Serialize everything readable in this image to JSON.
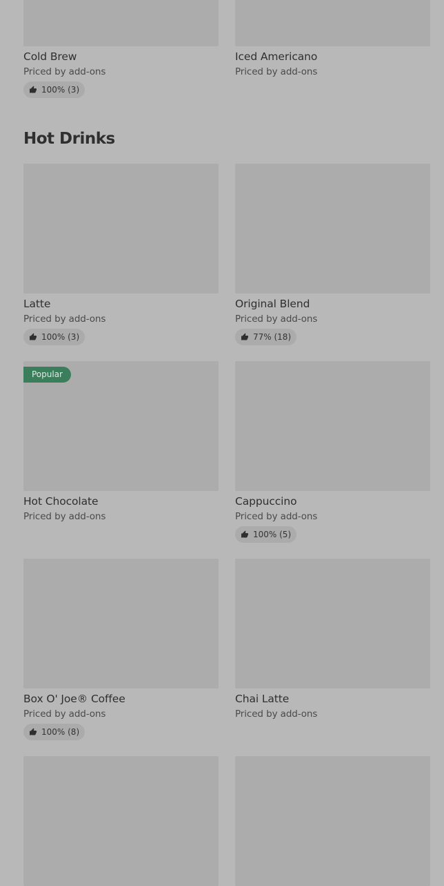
{
  "menu": {
    "top_items": [
      {
        "name": "Cold Brew",
        "price": "Priced by add-ons",
        "rating": "100% (3)"
      },
      {
        "name": "Iced Americano",
        "price": "Priced by add-ons"
      }
    ],
    "section": {
      "title": "Hot Drinks"
    },
    "items": [
      {
        "name": "Latte",
        "price": "Priced by add-ons",
        "rating": "100% (3)"
      },
      {
        "name": "Original Blend",
        "price": "Priced by add-ons",
        "rating": "77% (18)"
      },
      {
        "name": "Hot Chocolate",
        "price": "Priced by add-ons",
        "badge": "Popular"
      },
      {
        "name": "Cappuccino",
        "price": "Priced by add-ons",
        "rating": "100% (5)"
      },
      {
        "name": "Box O' Joe® Coffee",
        "price": "Priced by add-ons",
        "rating": "100% (8)"
      },
      {
        "name": "Chai Latte",
        "price": "Priced by add-ons"
      }
    ]
  },
  "colors": {
    "badge": "#3a7e5c",
    "background": "#b8b8b8",
    "image_placeholder": "#acacac"
  },
  "icons": {
    "rating": "thumbs-up-icon"
  }
}
